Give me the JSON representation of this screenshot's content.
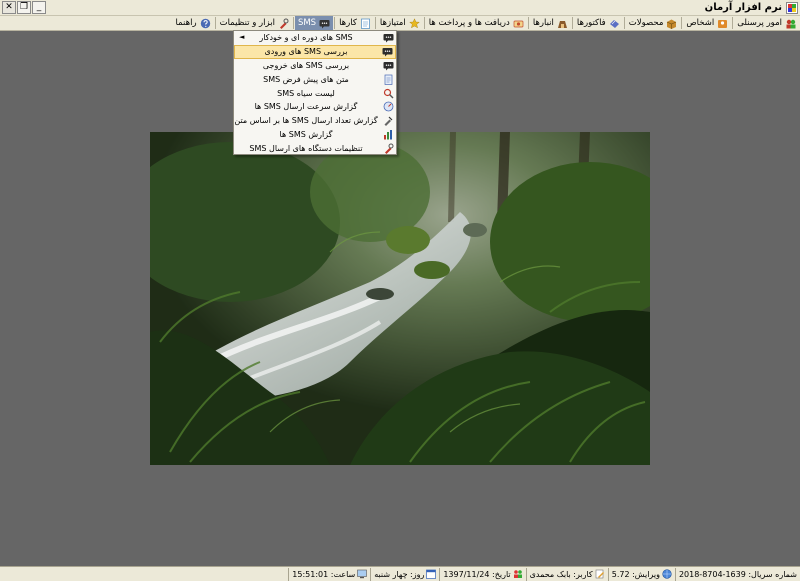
{
  "window": {
    "title": "نرم افزار آرمان",
    "minimize": "_",
    "restore": "❐",
    "close": "✕"
  },
  "menubar": {
    "items": [
      {
        "label": "امور پرسنلی",
        "icon": "people-icon",
        "color": "#c0392b"
      },
      {
        "label": "اشخاص",
        "icon": "contacts-icon",
        "color": "#e08a2a"
      },
      {
        "label": "محصولات",
        "icon": "box-icon",
        "color": "#c68a2e"
      },
      {
        "label": "فاکتورها",
        "icon": "invoice-icon",
        "color": "#5b6fc4"
      },
      {
        "label": "انبارها",
        "icon": "warehouse-icon",
        "color": "#8a5a2b"
      },
      {
        "label": "دریافت ها و پرداخت ها",
        "icon": "payment-icon",
        "color": "#c44b2e"
      },
      {
        "label": "امتیازها",
        "icon": "star-icon",
        "color": "#e8b820"
      },
      {
        "label": "کارها",
        "icon": "tasks-icon",
        "color": "#4a8ac4"
      },
      {
        "label": "SMS",
        "icon": "sms-icon",
        "color": "#333333"
      },
      {
        "label": "ابزار و تنظیمات",
        "icon": "tools-icon",
        "color": "#c0392b"
      },
      {
        "label": "راهنما",
        "icon": "help-icon",
        "color": "#4a6ab4"
      }
    ]
  },
  "sms_menu": {
    "items": [
      {
        "label": "SMS های دوره ای و خودکار",
        "icon": "sms-bubble-icon",
        "has_submenu": true
      },
      {
        "label": "بررسی SMS های ورودی",
        "icon": "sms-bubble-icon",
        "hover": true
      },
      {
        "label": "بررسی SMS های خروجی",
        "icon": "sms-bubble-icon"
      },
      {
        "label": "متن های پیش فرض SMS",
        "icon": "document-icon"
      },
      {
        "label": "لیست سیاه SMS",
        "icon": "blacklist-icon"
      },
      {
        "label": "گزارش سرعت ارسال SMS ها",
        "icon": "speed-icon"
      },
      {
        "label": "گزارش تعداد ارسال SMS ها بر اساس متن",
        "icon": "tools-report-icon"
      },
      {
        "label": "گزارش SMS ها",
        "icon": "chart-report-icon"
      },
      {
        "label": "تنظیمات دستگاه های ارسال SMS",
        "icon": "settings-wrench-icon"
      }
    ],
    "submenu_arrow": "◄"
  },
  "statusbar": {
    "serial": "شماره سریال: 1639-8704-2018",
    "version": "ویرایش: 5.72",
    "user": "کاربر: بابک محمدی",
    "date": "تاریخ: 1397/11/24",
    "day": "روز: چهار شنبه",
    "time": "ساعت: 15:51:01"
  },
  "colors": {
    "desktop": "#666666",
    "chrome": "#ece9d8",
    "menu_active": "#7b8fae",
    "menu_hover": "#fbe6a8"
  }
}
